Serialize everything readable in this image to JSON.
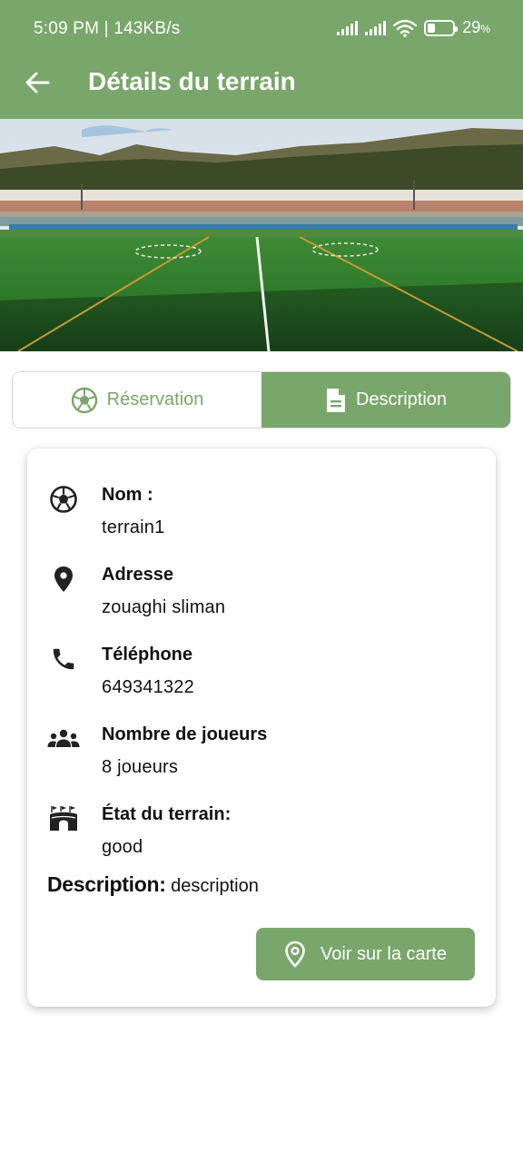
{
  "status_bar": {
    "time_speed": "5:09 PM | 143KB/s",
    "battery_percent": "29",
    "battery_unit": "%",
    "battery_level": 0.29
  },
  "header": {
    "title": "Détails du terrain",
    "back_icon": "arrow-left-icon"
  },
  "hero": {
    "icon": "stadium-photo"
  },
  "tabs": [
    {
      "label": "Réservation",
      "icon": "soccer-ball-icon",
      "active": false
    },
    {
      "label": "Description",
      "icon": "document-icon",
      "active": true
    }
  ],
  "details": {
    "nom": {
      "label": "Nom :",
      "value": "terrain1",
      "icon": "soccer-ball-icon"
    },
    "adresse": {
      "label": "Adresse",
      "value": "zouaghi sliman",
      "icon": "location-pin-icon"
    },
    "telephone": {
      "label": "Téléphone",
      "value": "649341322",
      "icon": "phone-icon"
    },
    "joueurs": {
      "label": "Nombre de joueurs",
      "value": "8 joueurs",
      "icon": "group-icon"
    },
    "etat": {
      "label": "État du terrain:",
      "value": "good",
      "icon": "stadium-icon"
    },
    "description": {
      "label": "Description:",
      "value": "description"
    }
  },
  "map_button": {
    "label": "Voir sur la carte",
    "icon": "map-pin-outline-icon"
  },
  "colors": {
    "accent": "#79a66a",
    "text": "#111111",
    "border": "#d6d6d6"
  }
}
